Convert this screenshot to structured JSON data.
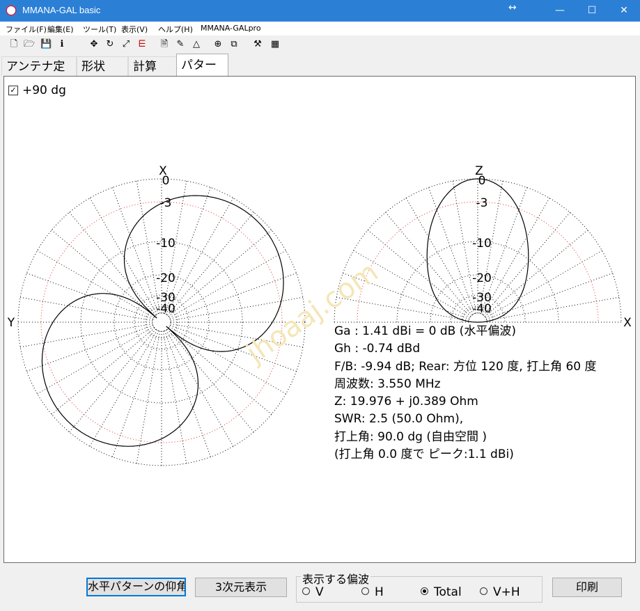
{
  "window": {
    "title": "MMANA-GAL basic",
    "minimize": "—",
    "maximize": "☐",
    "close": "✕",
    "resize_arrow": "↔"
  },
  "menu": [
    "ファイル(F)",
    "編集(E)",
    "ツール(T)",
    "表示(V)",
    "ヘルプ(H)",
    "MMANA-GALpro"
  ],
  "toolbar": {
    "icons": [
      "new-file-icon",
      "open-folder-icon",
      "save-icon",
      "info-icon",
      "move-icon",
      "rotate-icon",
      "resize-icon",
      "wire-icon",
      "document-icon",
      "draw-icon",
      "triangle-icon",
      "target-icon",
      "copy-icon",
      "tools-icon",
      "calculator-icon"
    ],
    "glyphs": [
      "🗋",
      "🗁",
      "💾",
      "ℹ",
      "✥",
      "↻",
      "⤢",
      "⋿",
      "🗎",
      "✎",
      "△",
      "⊕",
      "⧉",
      "⚒",
      "▦"
    ]
  },
  "tabs": [
    "アンテナ定義",
    "形状",
    "計算",
    "パターン"
  ],
  "active_tab": "パターン",
  "pattern": {
    "checkbox_label": "+90 dg",
    "checkbox_checked": true,
    "horizontal_plot": {
      "top_axis": "X",
      "left_axis": "Y",
      "ring_labels": [
        "0",
        "-3",
        "-10",
        "-20",
        "-30",
        "-40"
      ]
    },
    "vertical_plot": {
      "top_axis": "Z",
      "right_axis": "X",
      "ring_labels": [
        "0",
        "-3",
        "-10",
        "-20",
        "-30",
        "-40"
      ]
    },
    "watermark": "jhoaaj.com",
    "info_lines": [
      "Ga : 1.41 dBi = 0 dB (水平偏波)",
      "Gh : -0.74 dBd",
      "F/B: -9.94 dB; Rear: 方位 120 度,  打上角 60 度",
      "周波数: 3.550 MHz",
      "Z: 19.976 + j0.389 Ohm",
      "SWR: 2.5 (50.0 Ohm),",
      "打上角: 90.0 dg (自由空間 )",
      "(打上角 0.0 度で ピーク:1.1 dBi)"
    ]
  },
  "bottom": {
    "elev_button": "水平パターンの仰角",
    "three_d_button": "3次元表示",
    "polarization_group": "表示する偏波",
    "radios": [
      {
        "label": "V",
        "checked": false
      },
      {
        "label": "H",
        "checked": false
      },
      {
        "label": "Total",
        "checked": true
      },
      {
        "label": "V+H",
        "checked": false
      }
    ],
    "print_button": "印刷"
  },
  "colors": {
    "titlebar": "#2b80d6",
    "grid": "#000000",
    "ring_3db": "#e03030",
    "pattern_line": "#000000",
    "focus": "#0078d7"
  }
}
